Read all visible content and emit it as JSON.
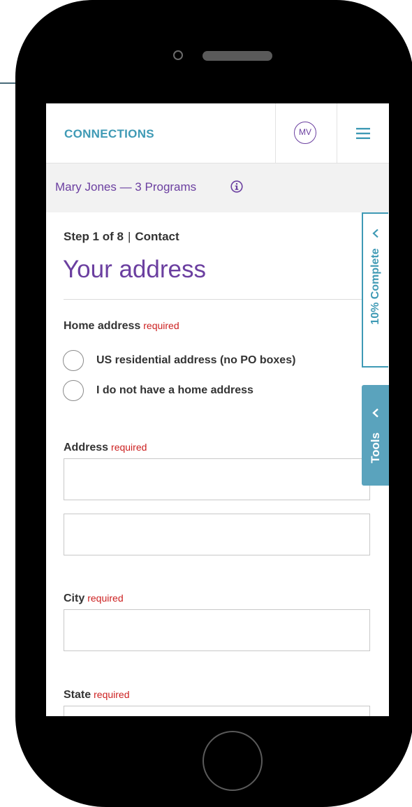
{
  "colors": {
    "brand": "#3f9ab5",
    "accent_purple": "#6b3fa0",
    "required_red": "#cc1f1f",
    "tools_tab": "#5aa3bd",
    "user_bar_bg": "#f2f2f2"
  },
  "header": {
    "brand": "CONNECTIONS",
    "avatar_initials": "MV",
    "menu_icon": "hamburger-menu-icon"
  },
  "user_bar": {
    "text": "Mary Jones — 3 Programs",
    "info_icon": "info-icon"
  },
  "step": {
    "number": "Step 1 of 8",
    "separator": "|",
    "section": "Contact"
  },
  "page_title": "Your address",
  "home_address": {
    "label": "Home address",
    "required": "required",
    "options": [
      "US residential address (no PO boxes)",
      "I do not have a home address"
    ]
  },
  "address": {
    "label": "Address",
    "required": "required",
    "line1_value": "",
    "line2_value": ""
  },
  "city": {
    "label": "City",
    "required": "required",
    "value": ""
  },
  "state": {
    "label": "State",
    "required": "required",
    "value": ""
  },
  "progress": {
    "label": "10% Complete",
    "percent": 10,
    "icon": "chevron-left-icon"
  },
  "tools": {
    "label": "Tools",
    "icon": "chevron-left-icon"
  }
}
